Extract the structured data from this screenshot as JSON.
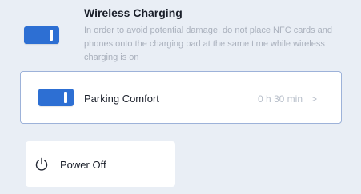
{
  "wireless_charging": {
    "title": "Wireless Charging",
    "description": "In order to avoid potential damage, do not place NFC cards and phones onto the charging pad at the same time while wireless charging is on",
    "enabled": true
  },
  "parking_comfort": {
    "title": "Parking Comfort",
    "value": "0 h 30 min",
    "enabled": true
  },
  "power_off": {
    "label": "Power Off",
    "icon": "power-icon"
  },
  "colors": {
    "accent": "#2d6fd3",
    "background": "#e9eef5",
    "selected_border": "#9db2d9"
  }
}
